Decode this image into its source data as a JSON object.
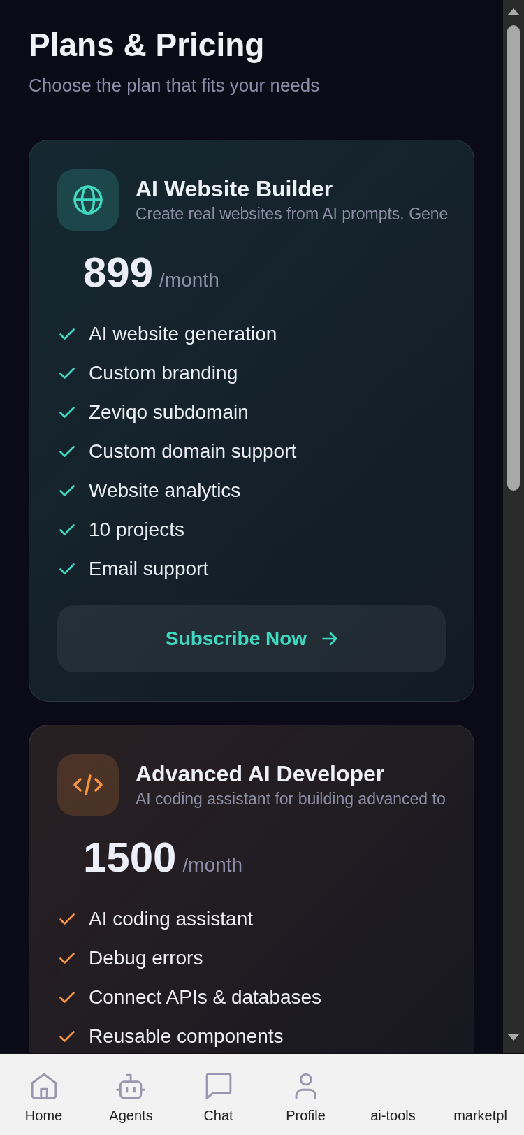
{
  "page": {
    "title": "Plans & Pricing",
    "subtitle": "Choose the plan that fits your needs"
  },
  "plans": [
    {
      "kind": "website",
      "color": "#3fd9c1",
      "name": "AI Website Builder",
      "description": "Create real websites from AI prompts. Gene",
      "price": "899",
      "period": "/month",
      "features": [
        "AI website generation",
        "Custom branding",
        "Zeviqo subdomain",
        "Custom domain support",
        "Website analytics",
        "10 projects",
        "Email support"
      ],
      "button": "Subscribe Now"
    },
    {
      "kind": "developer",
      "color": "#f5923e",
      "name": "Advanced AI Developer",
      "description": "AI coding assistant for building advanced to",
      "price": "1500",
      "period": "/month",
      "features": [
        "AI coding assistant",
        "Debug errors",
        "Connect APIs & databases",
        "Reusable components"
      ]
    }
  ],
  "bottom_nav": [
    {
      "kind": "home",
      "label": "Home"
    },
    {
      "kind": "agents",
      "label": "Agents"
    },
    {
      "kind": "chat",
      "label": "Chat"
    },
    {
      "kind": "profile",
      "label": "Profile"
    },
    {
      "kind": "text",
      "label": "ai-tools"
    },
    {
      "kind": "text",
      "label": "marketpl"
    }
  ]
}
